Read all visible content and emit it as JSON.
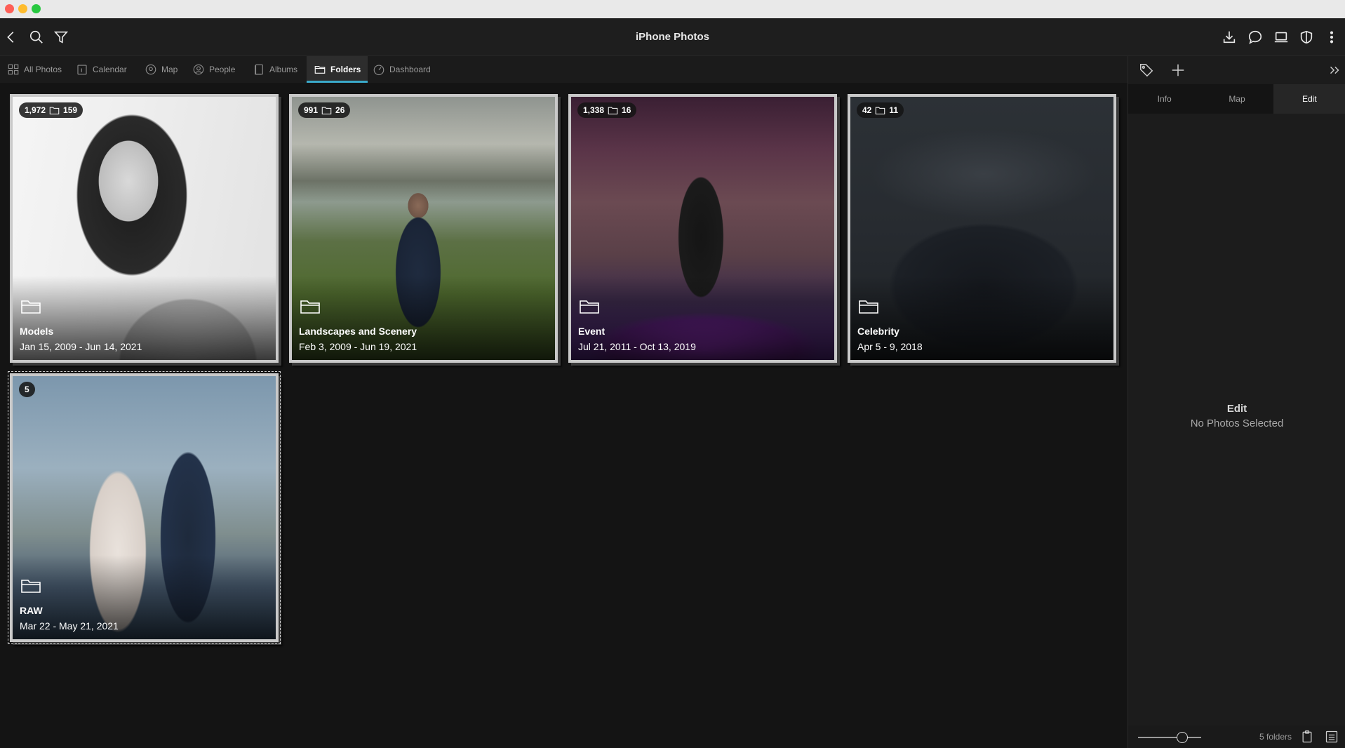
{
  "window": {
    "title": "iPhone Photos"
  },
  "toolbar": {
    "left_icons": [
      "back-chevron-icon",
      "search-icon",
      "filter-icon"
    ],
    "right_icons": [
      "download-icon",
      "chat-bubble-icon",
      "devices-icon",
      "shield-icon",
      "more-vertical-icon"
    ]
  },
  "nav": {
    "tabs": [
      {
        "label": "All Photos",
        "icon": "grid-icon"
      },
      {
        "label": "Calendar",
        "icon": "calendar-icon"
      },
      {
        "label": "Map",
        "icon": "map-pin-icon"
      },
      {
        "label": "People",
        "icon": "person-icon"
      },
      {
        "label": "Albums",
        "icon": "album-icon"
      },
      {
        "label": "Folders",
        "icon": "folder-icon",
        "active": true
      },
      {
        "label": "Dashboard",
        "icon": "gauge-icon"
      }
    ]
  },
  "folders": [
    {
      "name": "Models",
      "dates": "Jan 15, 2009 - Jun 14, 2021",
      "photo_count": "1,972",
      "folder_count": "159"
    },
    {
      "name": "Landscapes and Scenery",
      "dates": "Feb 3, 2009 - Jun 19, 2021",
      "photo_count": "991",
      "folder_count": "26"
    },
    {
      "name": "Event",
      "dates": "Jul 21, 2011 - Oct 13, 2019",
      "photo_count": "1,338",
      "folder_count": "16"
    },
    {
      "name": "Celebrity",
      "dates": "Apr 5 - 9, 2018",
      "photo_count": "42",
      "folder_count": "11"
    },
    {
      "name": "RAW",
      "dates": "Mar 22 - May 21, 2021",
      "photo_count": "5",
      "folder_count": ""
    }
  ],
  "panel": {
    "tabs": [
      "Info",
      "Map",
      "Edit"
    ],
    "active_tab": "Edit",
    "empty_title": "Edit",
    "empty_subtitle": "No Photos Selected",
    "folder_count_label": "5 folders",
    "zoom": 0.7
  },
  "colors": {
    "accent": "#3aa9c9",
    "background": "#141414",
    "toolbar": "#1e1e1e"
  }
}
